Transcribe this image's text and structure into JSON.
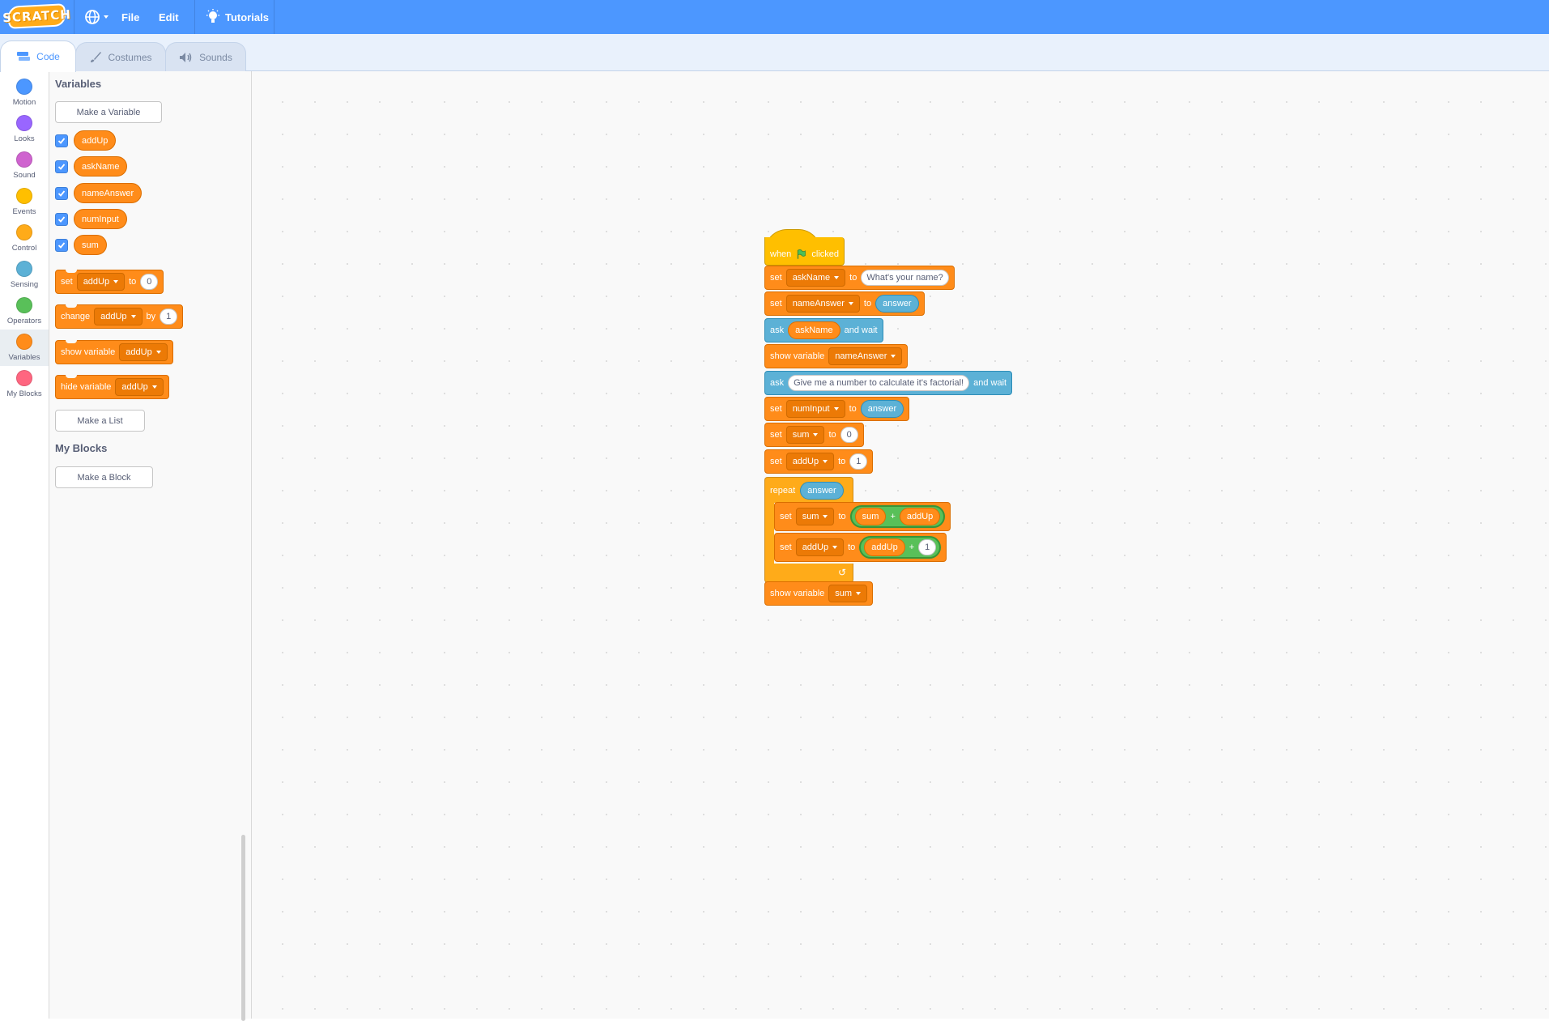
{
  "menubar": {
    "logo": "SCRATCH",
    "file": "File",
    "edit": "Edit",
    "tutorials": "Tutorials"
  },
  "tabs": [
    {
      "label": "Code",
      "icon": "code-icon"
    },
    {
      "label": "Costumes",
      "icon": "brush-icon"
    },
    {
      "label": "Sounds",
      "icon": "speaker-icon"
    }
  ],
  "categories": [
    {
      "label": "Motion",
      "color": "#4c97ff"
    },
    {
      "label": "Looks",
      "color": "#9966ff"
    },
    {
      "label": "Sound",
      "color": "#cf63cf"
    },
    {
      "label": "Events",
      "color": "#ffbf00"
    },
    {
      "label": "Control",
      "color": "#ffab19"
    },
    {
      "label": "Sensing",
      "color": "#5cb1d6"
    },
    {
      "label": "Operators",
      "color": "#59c059"
    },
    {
      "label": "Variables",
      "color": "#ff8c1a"
    },
    {
      "label": "My Blocks",
      "color": "#ff6680"
    }
  ],
  "flyout": {
    "variables_heading": "Variables",
    "make_variable": "Make a Variable",
    "variables": [
      "addUp",
      "askName",
      "nameAnswer",
      "numInput",
      "sum"
    ],
    "set_block": {
      "set": "set",
      "var": "addUp",
      "to": "to",
      "value": "0"
    },
    "change_block": {
      "change": "change",
      "var": "addUp",
      "by": "by",
      "value": "1"
    },
    "show_block": {
      "label": "show variable",
      "var": "addUp"
    },
    "hide_block": {
      "label": "hide variable",
      "var": "addUp"
    },
    "make_list": "Make a List",
    "myblocks_heading": "My Blocks",
    "make_block": "Make a Block"
  },
  "script": {
    "hat": {
      "when": "when",
      "clicked": "clicked"
    },
    "b1": {
      "set": "set",
      "var": "askName",
      "to": "to",
      "value": "What's your name?"
    },
    "b2": {
      "set": "set",
      "var": "nameAnswer",
      "to": "to",
      "value": "answer"
    },
    "b3": {
      "ask": "ask",
      "value": "askName",
      "wait": "and wait"
    },
    "b4": {
      "label": "show variable",
      "var": "nameAnswer"
    },
    "b5": {
      "ask": "ask",
      "value": "Give me a number to calculate it's factorial!",
      "wait": "and wait"
    },
    "b6": {
      "set": "set",
      "var": "numInput",
      "to": "to",
      "value": "answer"
    },
    "b7": {
      "set": "set",
      "var": "sum",
      "to": "to",
      "value": "0"
    },
    "b8": {
      "set": "set",
      "var": "addUp",
      "to": "to",
      "value": "1"
    },
    "repeat": {
      "label": "repeat",
      "value": "answer"
    },
    "r1": {
      "set": "set",
      "var": "sum",
      "to": "to",
      "left": "sum",
      "op": "+",
      "right": "addUp"
    },
    "r2": {
      "set": "set",
      "var": "addUp",
      "to": "to",
      "left": "addUp",
      "op": "+",
      "right": "1"
    },
    "last": {
      "label": "show variable",
      "var": "sum"
    }
  }
}
